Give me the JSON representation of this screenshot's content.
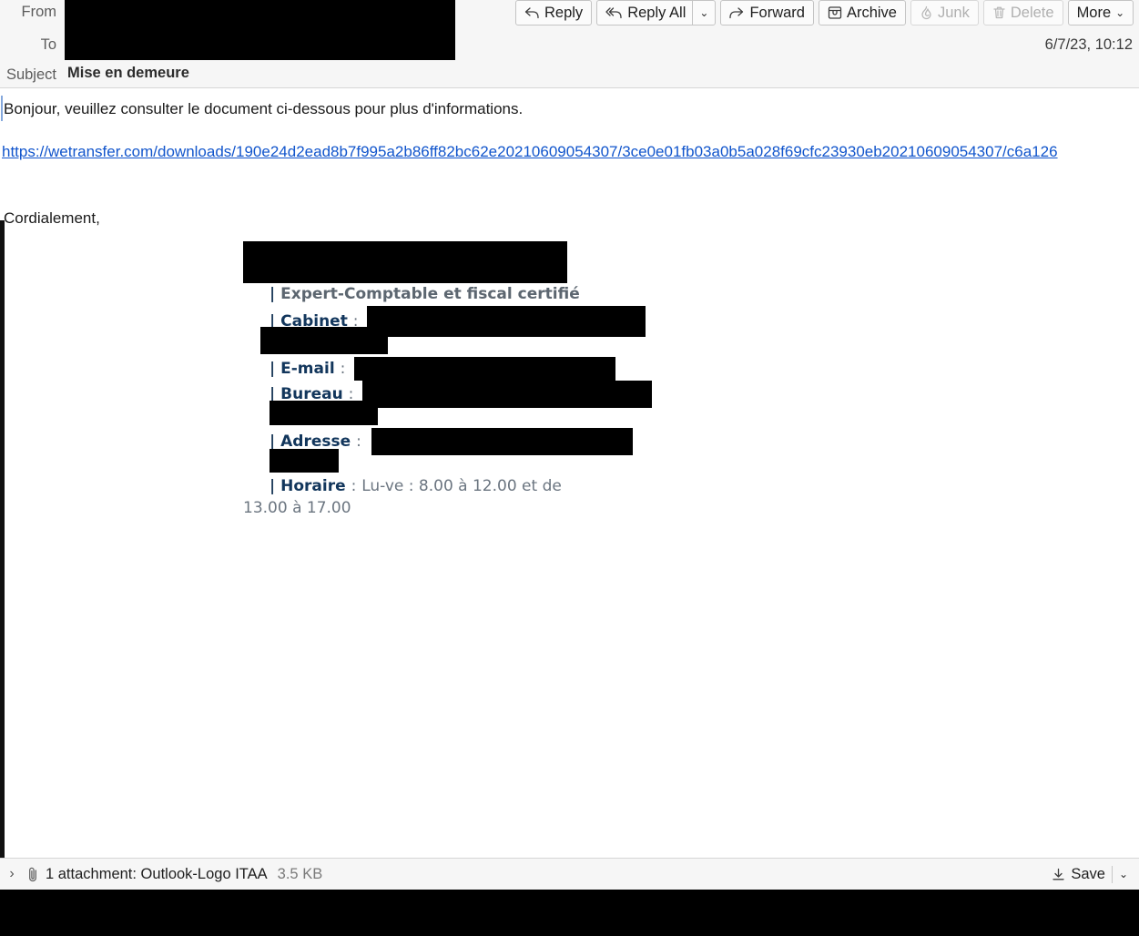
{
  "header": {
    "from_label": "From",
    "to_label": "To",
    "subject_label": "Subject",
    "subject_value": "Mise en demeure",
    "date": "6/7/23, 10:12",
    "from_redacted": true,
    "to_redacted": true
  },
  "toolbar": {
    "reply": {
      "label": "Reply",
      "icon": "reply-icon",
      "enabled": true
    },
    "reply_all": {
      "label": "Reply All",
      "icon": "reply-all-icon",
      "enabled": true
    },
    "reply_all_caret": {
      "icon": "chevron-down-icon"
    },
    "forward": {
      "label": "Forward",
      "icon": "forward-icon",
      "enabled": true
    },
    "archive": {
      "label": "Archive",
      "icon": "archive-icon",
      "enabled": true
    },
    "junk": {
      "label": "Junk",
      "icon": "flame-icon",
      "enabled": false
    },
    "delete": {
      "label": "Delete",
      "icon": "trash-icon",
      "enabled": false
    },
    "more": {
      "label": "More",
      "icon": "chevron-down-icon",
      "enabled": true
    }
  },
  "message": {
    "greeting": "Bonjour, veuillez consulter le document ci-dessous pour plus d'informations.",
    "link": "https://wetransfer.com/downloads/190e24d2ead8b7f995a2b86ff82bc62e20210609054307/3ce0e01fb03a0b5a028f69cfc23930eb20210609054307/c6a126",
    "closing": "Cordialement,"
  },
  "signature": {
    "name_redacted": true,
    "role_bar": "|",
    "role": "Expert-Comptable et fiscal certifié",
    "cabinet_label": "Cabinet",
    "cabinet_value_redacted": true,
    "email_label": "E-mail",
    "email_value_redacted": true,
    "bureau_label": "Bureau",
    "bureau_value_redacted": true,
    "adresse_label": "Adresse",
    "adresse_value_redacted": true,
    "horaire_label": "Horaire",
    "horaire_value": "Lu-ve : 8.00 à 12.00 et de 13.00 à 17.00",
    "colon": ":"
  },
  "attachment": {
    "expand_icon": "chevron-right-icon",
    "clip_icon": "paperclip-icon",
    "text": "1 attachment: Outlook-Logo ITAA",
    "size": "3.5 KB",
    "save_label": "Save",
    "save_icon": "download-icon",
    "save_caret": "chevron-down-icon"
  },
  "colors": {
    "link": "#1155cc",
    "header_bg": "#f6f6f6",
    "sig_label": "#12365c",
    "sig_text": "#6b7580",
    "redaction": "#000000"
  }
}
